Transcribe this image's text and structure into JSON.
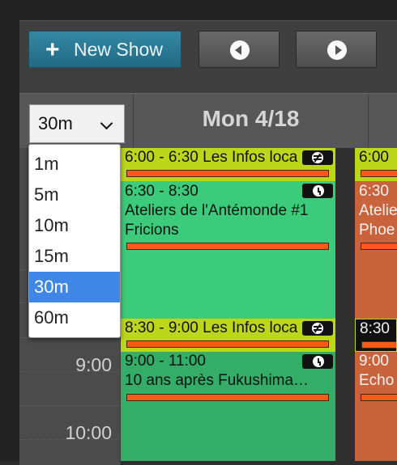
{
  "toolbar": {
    "new_show_label": "New Show",
    "prev_icon": "previous-arrow-icon",
    "next_icon": "next-arrow-icon"
  },
  "calendar": {
    "day_title": "Mon 4/18",
    "interval_select": {
      "value": "30m",
      "options": [
        "1m",
        "5m",
        "10m",
        "15m",
        "30m",
        "60m"
      ],
      "selected": "30m"
    },
    "time_labels": [
      "9:00",
      "10:00"
    ]
  },
  "events": [
    {
      "time": "6:00 - 6:30",
      "title": "Les Infos loca",
      "icon": "repeat-icon"
    },
    {
      "time": "6:30 - 8:30",
      "title": "Ateliers de l'Antémonde #1",
      "title2": "Fricions",
      "icon": "clock-icon"
    },
    {
      "time": "8:30 - 9:00",
      "title": "Les Infos loca",
      "icon": "repeat-icon"
    },
    {
      "time": "9:00 - 11:00",
      "title": "10 ans après Fukushima…",
      "icon": "clock-icon"
    }
  ],
  "events_next_day": [
    {
      "time": "6:00"
    },
    {
      "time": "6:30",
      "title": "Atelie",
      "title2": "Phoe"
    },
    {
      "time": "8:30"
    },
    {
      "time": "9:00",
      "title": "Echo"
    }
  ],
  "colors": {
    "accent_button": "#2a7a95",
    "event_yellow": "#bcd61a",
    "event_green": "#3ccb7a",
    "event_green_dark": "#34ad69",
    "event_orange_red": "#c9633c",
    "progress_bar": "#ff5a17",
    "dropdown_selected": "#3f86e6"
  }
}
